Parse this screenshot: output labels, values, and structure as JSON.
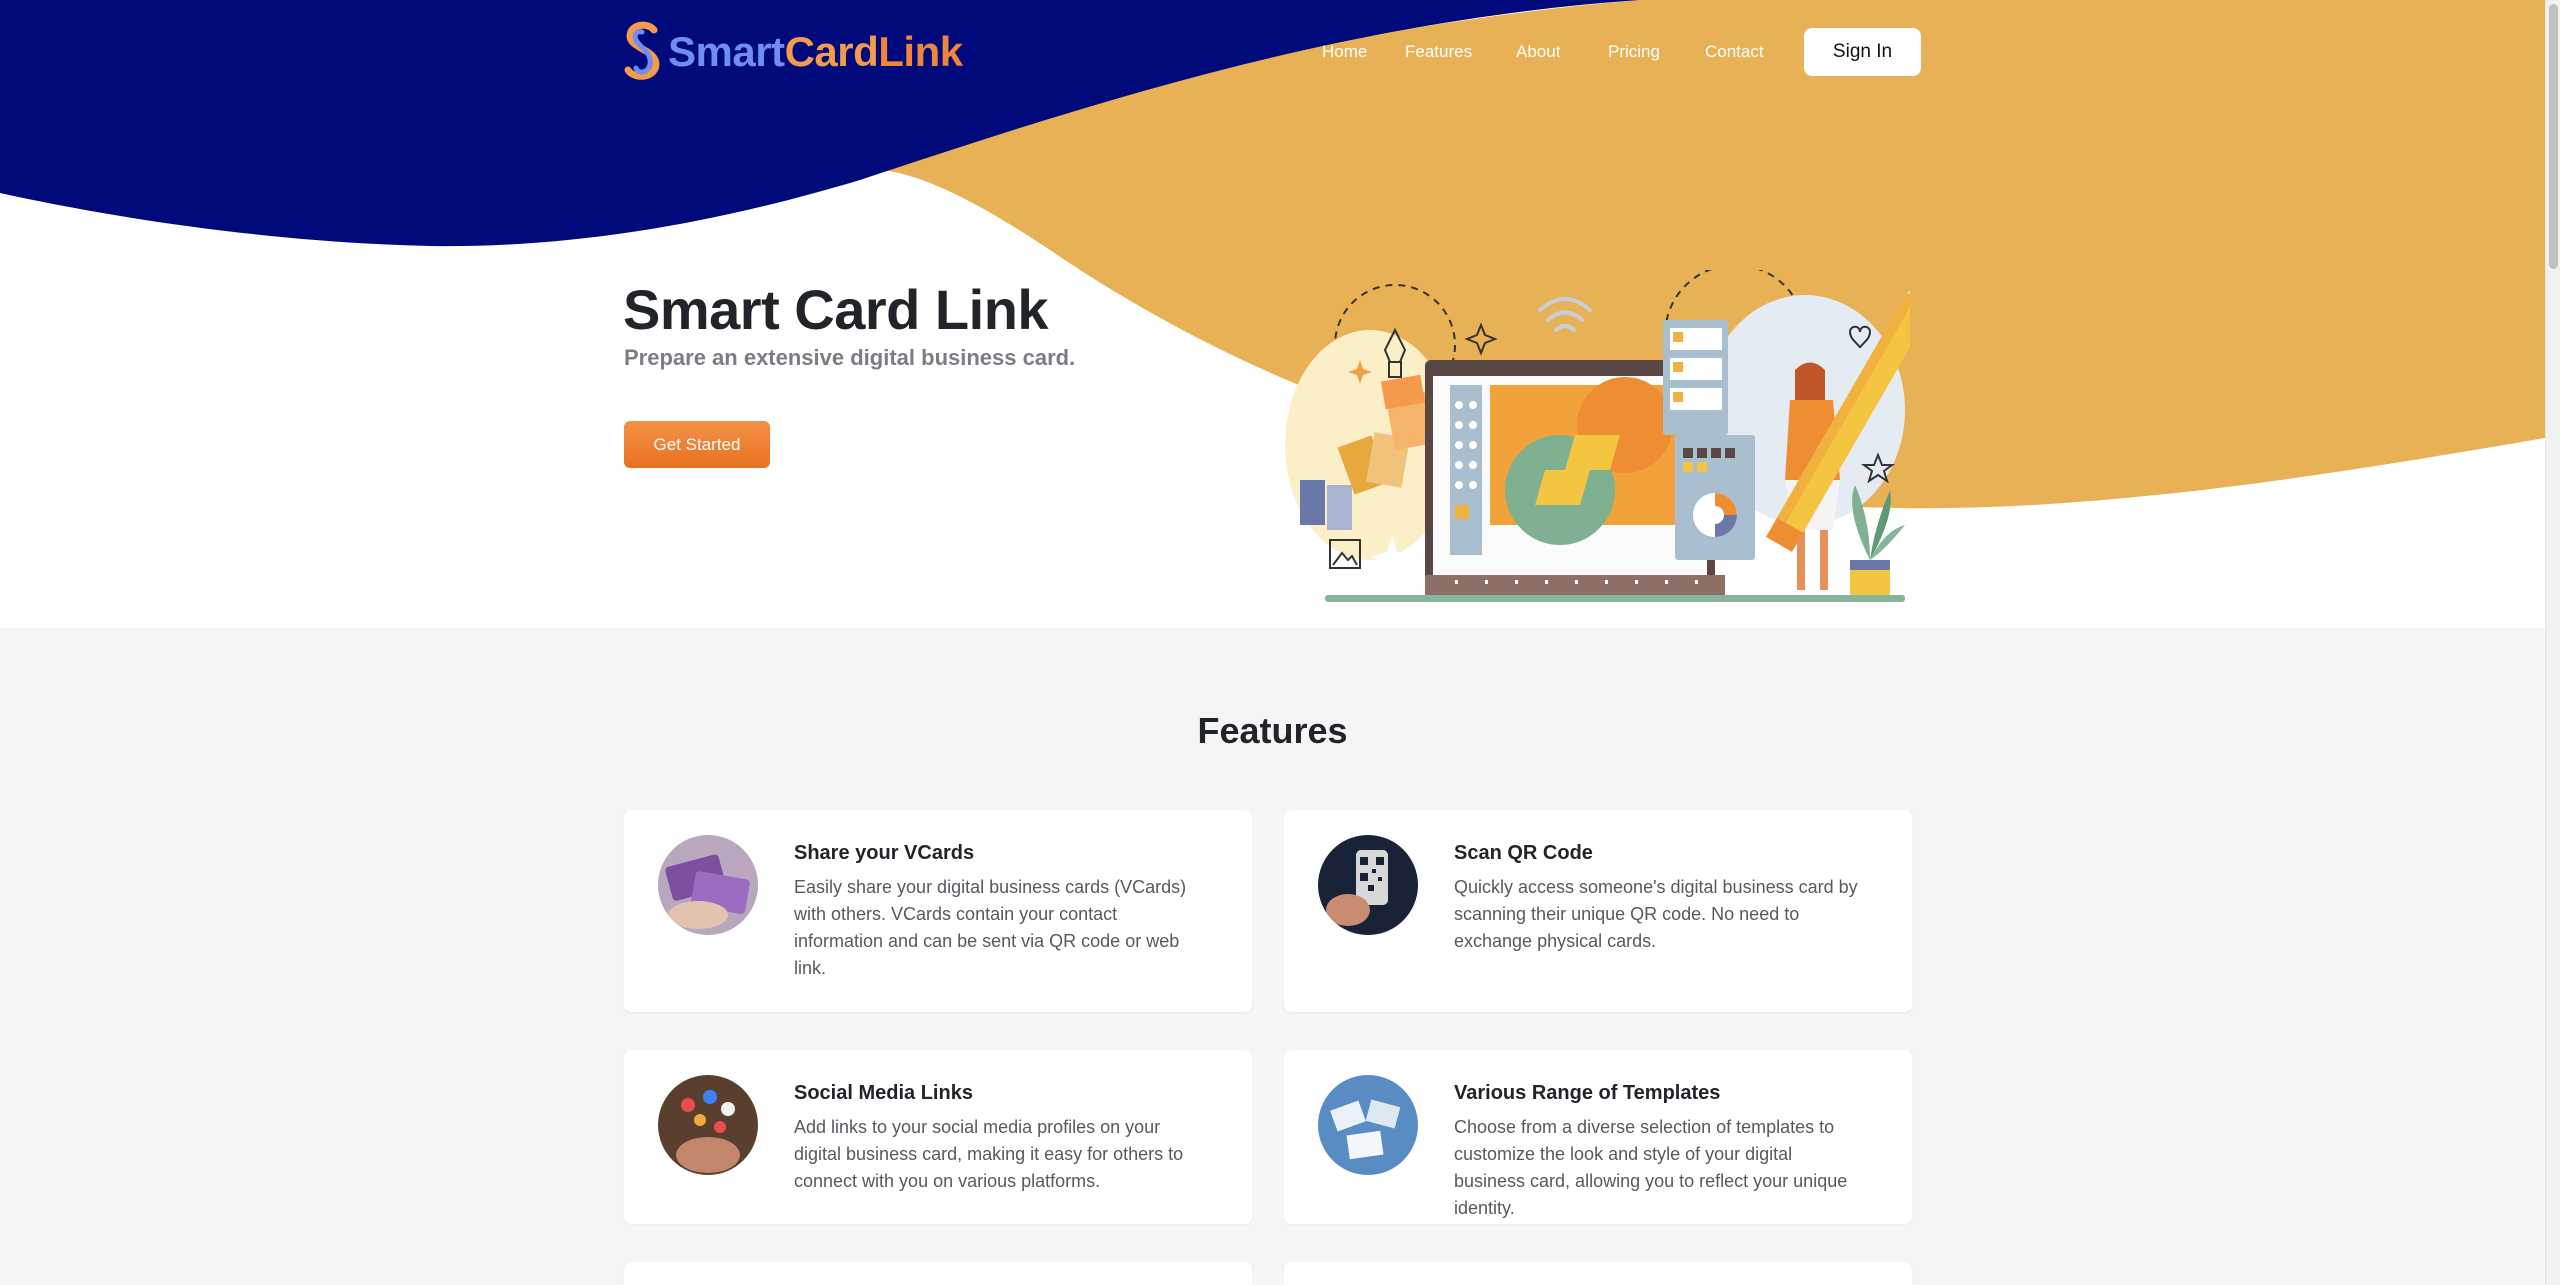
{
  "header": {
    "logo": {
      "smart": "Smart",
      "card": "Card",
      "link": "Link"
    },
    "nav": [
      "Home",
      "Features",
      "About",
      "Pricing",
      "Contact"
    ],
    "sign_in": "Sign In"
  },
  "hero": {
    "title": "Smart Card Link",
    "subtitle": "Prepare an extensive digital business card.",
    "cta": "Get Started"
  },
  "features": {
    "title": "Features",
    "cards": [
      {
        "title": "Share your VCards",
        "desc": "Easily share your digital business cards (VCards) with others. VCards contain your contact information and can be sent via QR code or web link."
      },
      {
        "title": "Scan QR Code",
        "desc": "Quickly access someone's digital business card by scanning their unique QR code. No need to exchange physical cards."
      },
      {
        "title": "Social Media Links",
        "desc": "Add links to your social media profiles on your digital business card, making it easy for others to connect with you on various platforms."
      },
      {
        "title": "Various Range of Templates",
        "desc": "Choose from a diverse selection of templates to customize the look and style of your digital business card, allowing you to reflect your unique identity."
      }
    ]
  },
  "colors": {
    "navy": "#000a7a",
    "gold": "#e8b155",
    "accent": "#ec7b2b"
  }
}
